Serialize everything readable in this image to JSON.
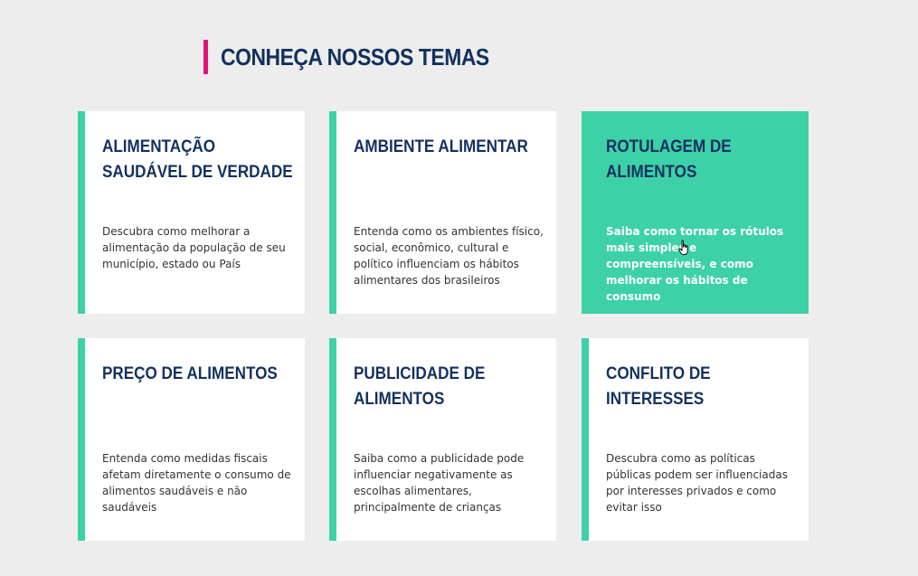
{
  "section": {
    "title": "CONHEÇA NOSSOS TEMAS"
  },
  "colors": {
    "accent": "#3dd1a8",
    "title_bar": "#e0157a",
    "heading": "#13305f",
    "background": "#ededed"
  },
  "cards": [
    {
      "title_line1": "ALIMENTAÇÃO",
      "title_line2": "SAUDÁVEL DE VERDADE",
      "description": "Descubra como melhorar a alimentação da população de seu município, estado ou País"
    },
    {
      "title_line1": "AMBIENTE ALIMENTAR",
      "title_line2": "",
      "description": "Entenda como os ambientes físico, social, econômico, cultural e político influenciam os hábitos alimentares dos brasileiros"
    },
    {
      "title_line1": "ROTULAGEM DE",
      "title_line2": "ALIMENTOS",
      "description": "Saiba como tornar os rótulos mais simples e compreensíveis, e como melhorar os hábitos de consumo"
    },
    {
      "title_line1": "PREÇO DE ALIMENTOS",
      "title_line2": "",
      "description": "Entenda como medidas fiscais afetam diretamente o consumo de alimentos saudáveis e não saudáveis"
    },
    {
      "title_line1": "PUBLICIDADE DE",
      "title_line2": "ALIMENTOS",
      "description": "Saiba como a publicidade pode influenciar negativamente as escolhas alimentares, principalmente de crianças"
    },
    {
      "title_line1": "CONFLITO DE",
      "title_line2": "INTERESSES",
      "description": "Descubra como as políticas públicas podem ser influenciadas por interesses privados e como evitar isso"
    }
  ],
  "cursor": "hand-pointer-icon"
}
